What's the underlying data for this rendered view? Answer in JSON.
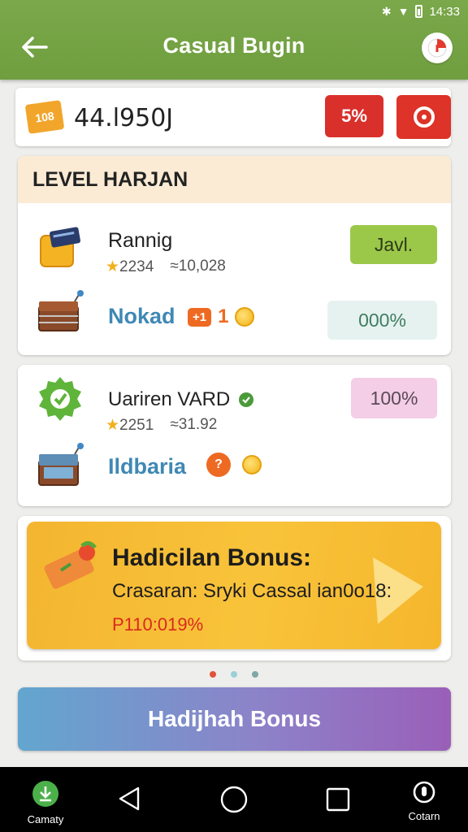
{
  "status_bar": {
    "time": "14:33"
  },
  "app_bar": {
    "title": "Casual Bugin"
  },
  "balance": {
    "ticket_label": "108",
    "value": "44.l950J",
    "percent_button": "5%"
  },
  "level_card": {
    "header": "LEVEL HARJAN",
    "row1": {
      "title": "Rannig",
      "stat_a": "2234",
      "stat_b": "≈10,028",
      "action": "Javl."
    },
    "row2": {
      "name": "Nokad",
      "badge": "+1",
      "count": "1",
      "value": "000%"
    }
  },
  "card2": {
    "row1": {
      "title": "Uariren VARD",
      "stat_a": "2251",
      "stat_b": "≈31.92",
      "value": "100%"
    },
    "row2": {
      "name": "Ildbaria"
    }
  },
  "bonus": {
    "title": "Hadicilan Bonus:",
    "subtitle": "Crasaran: Sryki Cassal ian0o18:",
    "footer": "P110:019%"
  },
  "pagination": {
    "colors": [
      "#e0533a",
      "#9ad0d8",
      "#7fa7a5"
    ]
  },
  "cta": {
    "label": "Hadijhah Bonus"
  },
  "nav": {
    "left_label": "Camaty",
    "right_label": "Cotarn"
  },
  "colors": {
    "appbar": "#7aa84a",
    "accent_red": "#d9302b",
    "pill_green": "#9cc84a",
    "pill_teal": "#e6f2ef",
    "pill_pink": "#f4cde6",
    "bonus_yellow": "#f8c33a"
  }
}
